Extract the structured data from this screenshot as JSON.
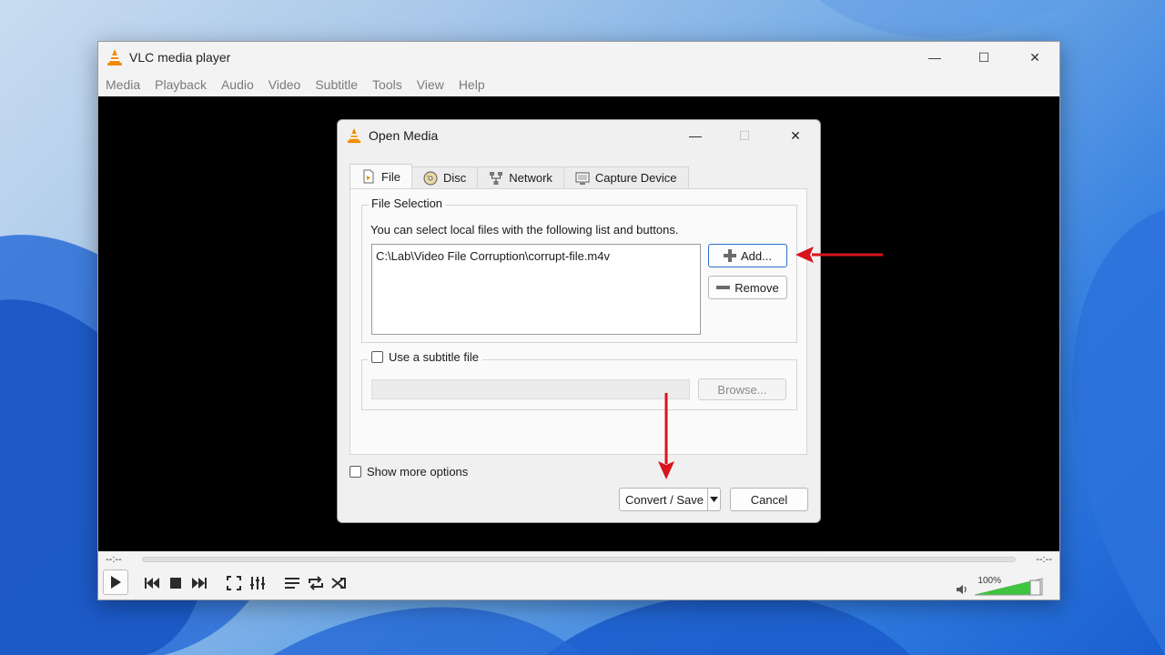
{
  "app": {
    "title": "VLC media player",
    "menu": [
      "Media",
      "Playback",
      "Audio",
      "Video",
      "Subtitle",
      "Tools",
      "View",
      "Help"
    ],
    "window_controls": {
      "minimize": "—",
      "maximize": "☐",
      "close": "✕"
    }
  },
  "controls": {
    "time_elapsed": "--:--",
    "time_total": "--:--",
    "volume_label": "100%",
    "volume_level": 1.0,
    "buttons": [
      "play-icon",
      "previous-icon",
      "stop-icon",
      "next-icon",
      "fullscreen-icon",
      "extended-settings-icon",
      "playlist-icon",
      "loop-icon",
      "shuffle-icon"
    ]
  },
  "dialog": {
    "title": "Open Media",
    "tabs": [
      {
        "label": "File",
        "icon": "file-icon",
        "active": true
      },
      {
        "label": "Disc",
        "icon": "disc-icon",
        "active": false
      },
      {
        "label": "Network",
        "icon": "network-icon",
        "active": false
      },
      {
        "label": "Capture Device",
        "icon": "capture-device-icon",
        "active": false
      }
    ],
    "file_selection": {
      "legend": "File Selection",
      "description": "You can select local files with the following list and buttons.",
      "files": [
        "C:\\Lab\\Video File Corruption\\corrupt-file.m4v"
      ],
      "add_label": "Add...",
      "remove_label": "Remove"
    },
    "subtitle": {
      "label": "Use a subtitle file",
      "checked": false,
      "path": "",
      "browse_label": "Browse..."
    },
    "show_more_options": {
      "label": "Show more options",
      "checked": false
    },
    "convert_save_label": "Convert / Save",
    "cancel_label": "Cancel"
  },
  "annotation": {
    "arrow_color": "#d8141c"
  },
  "colors": {
    "accent": "#2d6fc4",
    "vlc_orange": "#f08a00",
    "volume_green": "#3fc43f"
  }
}
